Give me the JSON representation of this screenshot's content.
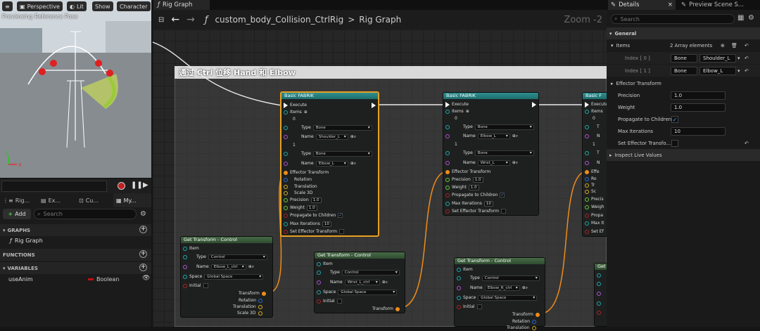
{
  "viewport": {
    "menu_icon": "hamburger-icon",
    "perspective_label": "Perspective",
    "lit_label": "Lit",
    "show_label": "Show",
    "character_label": "Character",
    "caption": "Previewing Reference Pose"
  },
  "left_panel": {
    "tabs": [
      {
        "label": "Rig..."
      },
      {
        "label": "Ex..."
      },
      {
        "label": "Cu..."
      },
      {
        "label": "My..."
      }
    ],
    "add_label": "Add",
    "search_placeholder": "Search",
    "graphs_header": "GRAPHS",
    "rig_graph_item": "Rig Graph",
    "functions_header": "FUNCTIONS",
    "variables_header": "VARIABLES",
    "variable_name": "useAnim",
    "variable_type": "Boolean",
    "variable_type_color": "#c01010"
  },
  "graph": {
    "tab_label": "Rig Graph",
    "breadcrumb_root": "custom_body_Collision_CtrlRig",
    "breadcrumb_sep": ">",
    "breadcrumb_leaf": "Rig Graph",
    "zoom_label": "Zoom -2",
    "comment_title": "通过 Ctrl 位移 Hand 和 Elbow"
  },
  "fabrik_nodes": [
    {
      "title": "Basic FABRIK",
      "execute_label": "Execute",
      "items_label": "Items",
      "idx0_label": "0",
      "type_label": "Type",
      "type0": "Bone",
      "name_label": "Name",
      "name0": "Shoulder_L",
      "idx1_label": "1",
      "type1": "Bone",
      "name1": "Elbow_L",
      "effector_label": "Effector Transform",
      "rotation_label": "Rotation",
      "translation_label": "Translation",
      "scale_label": "Scale 3D",
      "precision_label": "Precision",
      "precision": "1.0",
      "weight_label": "Weight",
      "weight": "1.0",
      "propagate_label": "Propagate to Children",
      "max_iter_label": "Max Iterations",
      "max_iter": "10",
      "set_effector_label": "Set Effector Transform"
    },
    {
      "title": "Basic FABRIK",
      "execute_label": "Execute",
      "items_label": "Items",
      "idx0_label": "0",
      "type_label": "Type",
      "type0": "Bone",
      "name_label": "Name",
      "name0": "Elbow_L",
      "idx1_label": "1",
      "type1": "Bone",
      "name1": "Wrist_L",
      "effector_label": "Effector Transform",
      "precision_label": "Precision",
      "precision": "1.0",
      "weight_label": "Weight",
      "weight": "1.0",
      "propagate_label": "Propagate to Children",
      "max_iter_label": "Max Iterations",
      "max_iter": "10",
      "set_effector_label": "Set Effector Transform"
    },
    {
      "title": "Basic F",
      "execute_label": "Execute",
      "items_label": "Items",
      "c1": "0",
      "c2": "T",
      "c3": "N",
      "c4": "1",
      "c5": "T",
      "c6": "N",
      "c7": "Effe",
      "c8": "Ro",
      "c9": "Tr",
      "c10": "Sc",
      "c11": "Precis",
      "c12": "Weigh",
      "c13": "Propa",
      "c14": "Max It",
      "c15": "Set Ef"
    }
  ],
  "get_transform_nodes": [
    {
      "title": "Get Transform - Control",
      "item_label": "Item",
      "type_label": "Type",
      "type": "Control",
      "name_label": "Name",
      "name": "Elbow_L_ctrl",
      "space_label": "Space",
      "space": "Global Space",
      "initial_label": "Initial",
      "transform_label": "Transform",
      "rotation_label": "Rotation",
      "translation_label": "Translation",
      "scale_label": "Scale 3D"
    },
    {
      "title": "Get Transform - Control",
      "item_label": "Item",
      "type_label": "Type",
      "type": "Control",
      "name_label": "Name",
      "name": "Wrist_L_ctrl",
      "space_label": "Space",
      "space": "Global Space",
      "initial_label": "Initial",
      "transform_label": "Transform"
    },
    {
      "title": "Get Transform - Control",
      "item_label": "Item",
      "type_label": "Type",
      "type": "Control",
      "name_label": "Name",
      "name": "Elbow_R_ctrl",
      "space_label": "Space",
      "space": "Global Space",
      "initial_label": "Initial",
      "transform_label": "Transform",
      "rotation_label": "Rotation",
      "translation_label": "Translation"
    },
    {
      "title": "Get"
    }
  ],
  "details": {
    "tab_label": "Details",
    "preview_tab_label": "Preview Scene S...",
    "search_placeholder": "Search",
    "general_header": "General",
    "items_label": "Items",
    "items_count": "2 Array elements",
    "index0_label": "Index [ 0 ]",
    "index0_type": "Bone",
    "index0_name": "Shoulder_L",
    "index1_label": "Index [ 1 ]",
    "index1_type": "Bone",
    "index1_name": "Elbow_L",
    "effector_label": "Effector Transform",
    "precision_label": "Precision",
    "precision": "1.0",
    "weight_label": "Weight",
    "weight": "1.0",
    "propagate_label": "Propagate to Children",
    "max_iter_label": "Max Iterations",
    "max_iter": "10",
    "set_effector_label": "Set Effector Transfo...",
    "inspect_label": "Inspect Live Values"
  }
}
